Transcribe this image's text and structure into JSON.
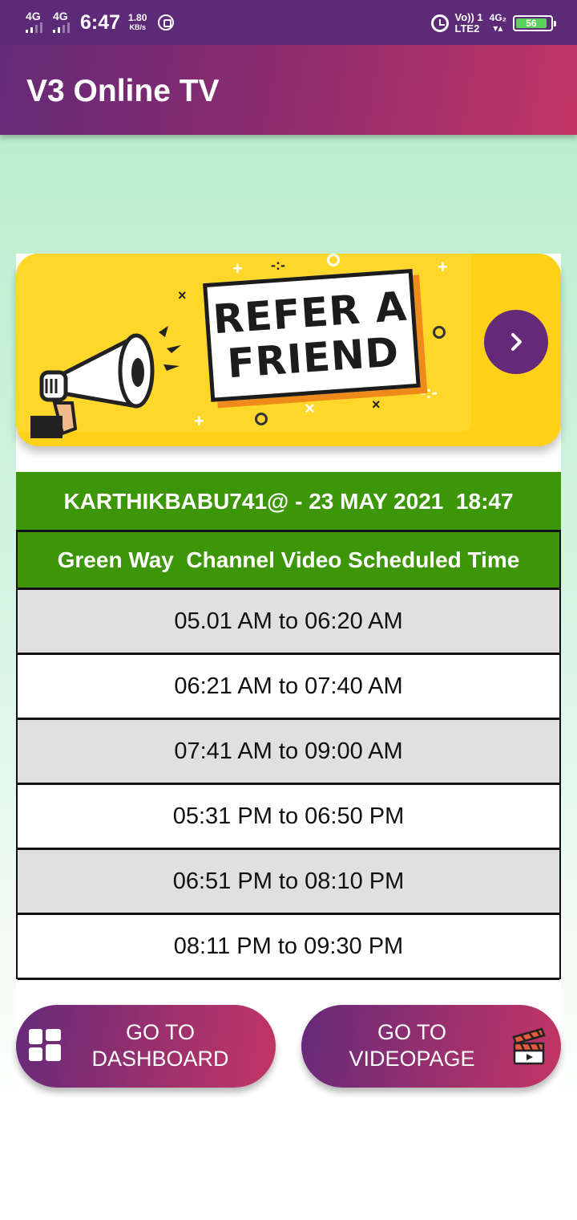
{
  "status_bar": {
    "network_1": "4G",
    "network_2": "4G",
    "time": "6:47",
    "speed_value": "1.80",
    "speed_unit": "KB/s",
    "volte_label": "Vo)) 1",
    "lte_label": "LTE2",
    "network_3": "4G₂",
    "battery_level": "56"
  },
  "app_bar": {
    "title": "V3 Online TV"
  },
  "banner": {
    "line1": "REFER A",
    "line2": "FRIEND",
    "accent_color": "#fdd117"
  },
  "user_bar": {
    "text": "KARTHIKBABU741@ - 23 MAY 2021  18:47"
  },
  "schedule": {
    "header": "Green Way  Channel Video Scheduled Time",
    "slots": [
      "05.01 AM to 06:20 AM",
      "06:21 AM to 07:40 AM",
      "07:41 AM to 09:00 AM",
      "05:31 PM to 06:50 PM",
      "06:51 PM to 08:10 PM",
      "08:11 PM to 09:30 PM"
    ]
  },
  "buttons": {
    "dashboard_line1": "GO TO",
    "dashboard_line2": "DASHBOARD",
    "videopage_line1": "GO TO",
    "videopage_line2": "VIDEOPAGE"
  },
  "colors": {
    "primary_purple": "#632a78",
    "accent_pink": "#c23565",
    "green": "#3d9608"
  }
}
